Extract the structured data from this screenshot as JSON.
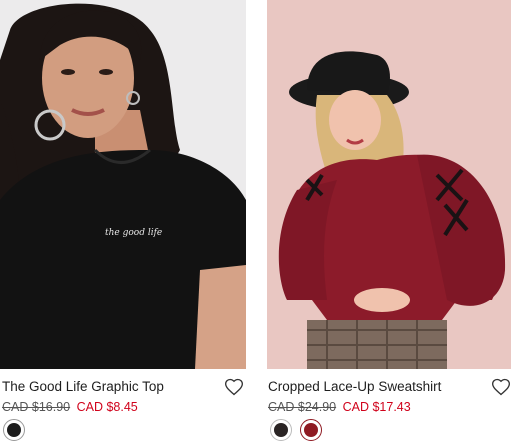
{
  "products": [
    {
      "name": "The Good Life Graphic Top",
      "original_price": "CAD $16.90",
      "sale_price": "CAD $8.45",
      "print_text": "the good life",
      "wishlist_icon": "heart-outline-icon",
      "swatches": [
        {
          "color_name": "black",
          "hex": "#1d1d1d",
          "selected": true
        }
      ]
    },
    {
      "name": "Cropped Lace-Up Sweatshirt",
      "original_price": "CAD $24.90",
      "sale_price": "CAD $17.43",
      "wishlist_icon": "heart-outline-icon",
      "swatches": [
        {
          "color_name": "black",
          "hex": "#2a2424",
          "selected": false
        },
        {
          "color_name": "burgundy",
          "hex": "#8f1a22",
          "selected": true
        }
      ]
    }
  ],
  "colors": {
    "sale_price": "#d0021b",
    "original_price": "#555555",
    "product_name": "#1e1e1e"
  }
}
